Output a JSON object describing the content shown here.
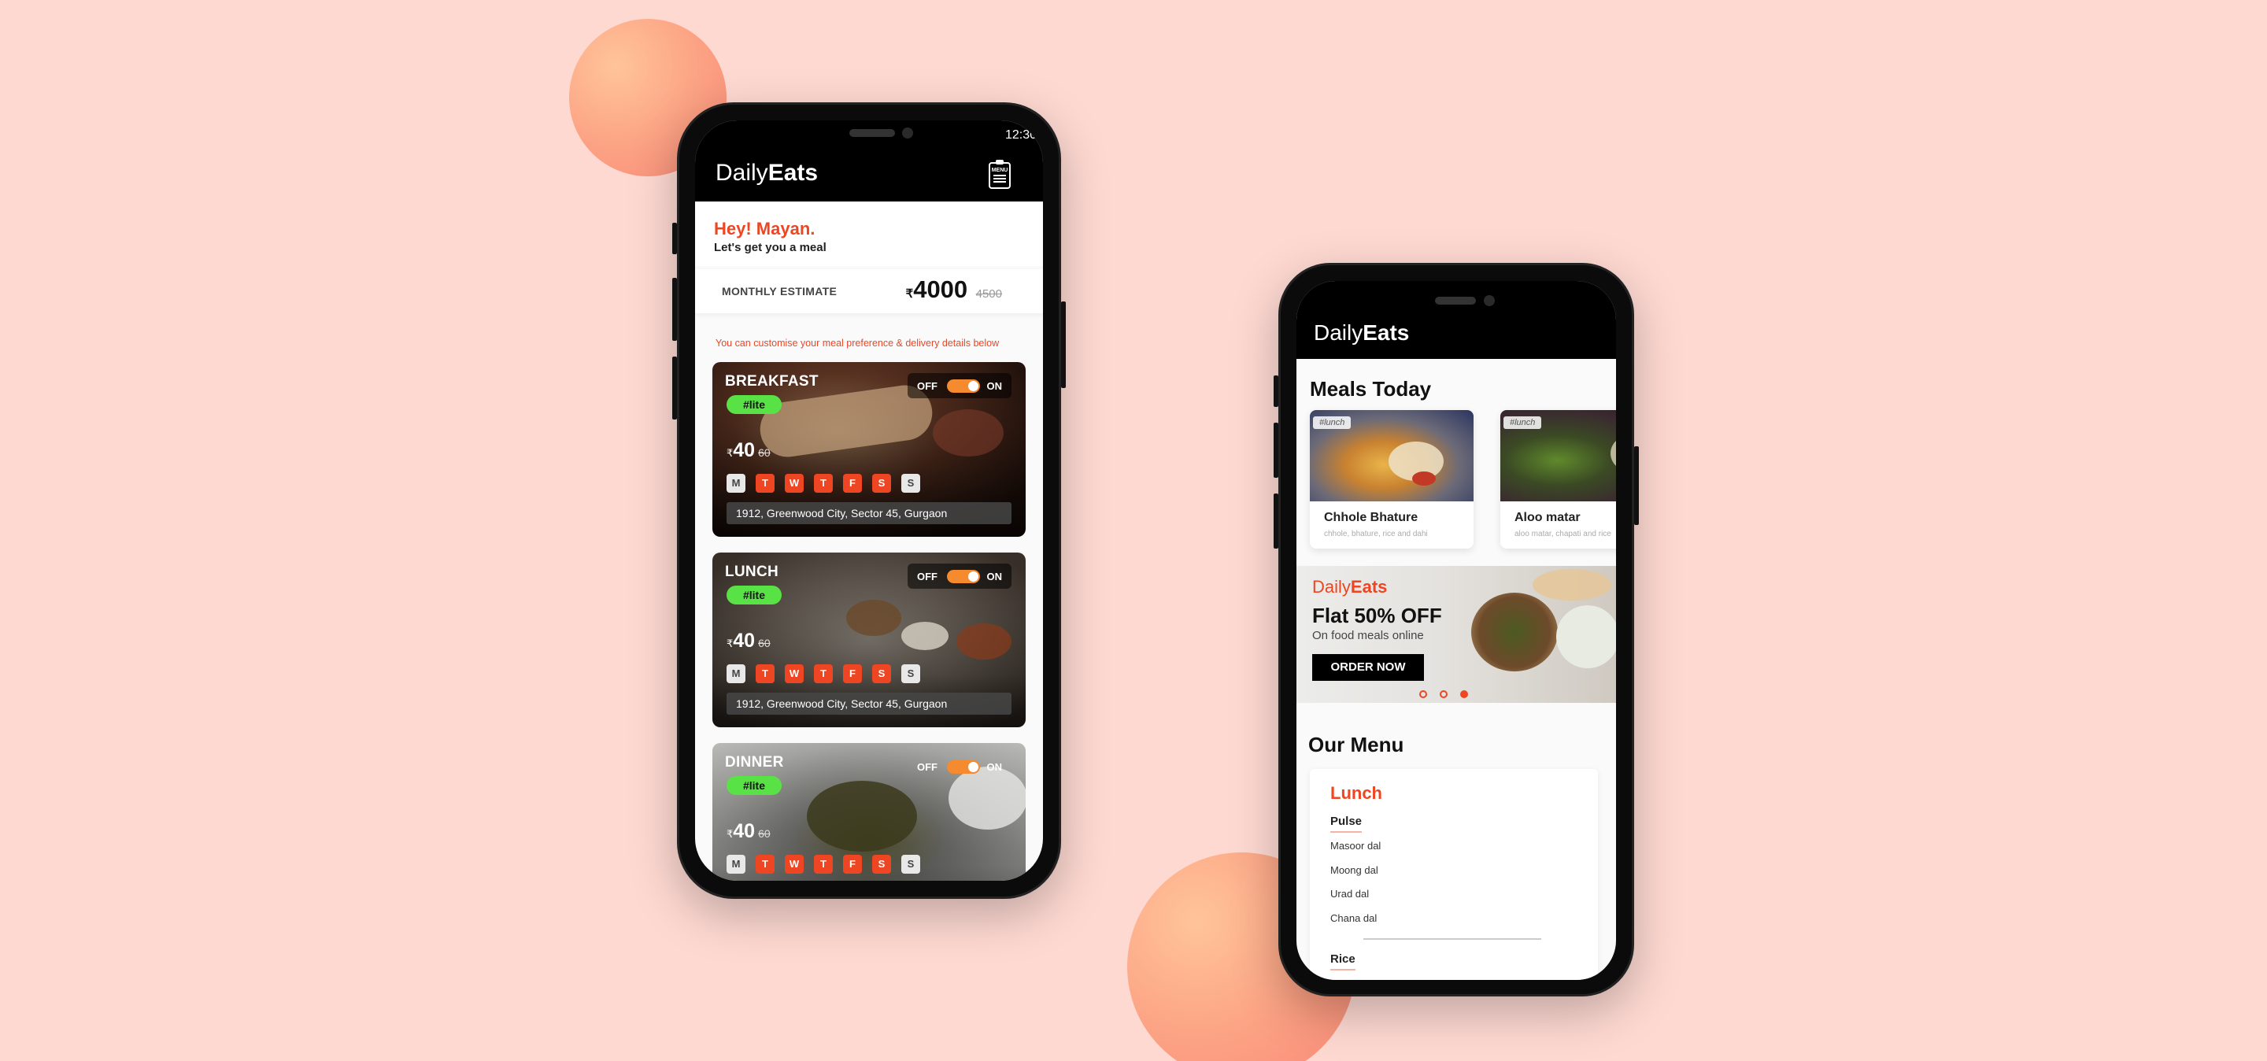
{
  "colors": {
    "accent": "#ee4523",
    "lite": "#59e245",
    "toggle": "#f68a2e",
    "background": "#fed9d2"
  },
  "phone1": {
    "time": "12:30",
    "brand_light": "Daily",
    "brand_bold": "Eats",
    "menu_icon": "clipboard-menu-icon",
    "menu_icon_text": "MENU",
    "greeting": "Hey! Mayan.",
    "greeting_sub": "Let's get you a meal",
    "estimate_label": "MONTHLY ESTIMATE",
    "currency": "₹",
    "estimate_value": "4000",
    "estimate_old": "4500",
    "hint": "You can customise your meal preference & delivery details below",
    "meals": [
      {
        "title": "BREAKFAST",
        "tag": "#lite",
        "off": "OFF",
        "on": "ON",
        "price": "40",
        "old": "60",
        "days": [
          "M",
          "T",
          "W",
          "T",
          "F",
          "S",
          "S"
        ],
        "address": "1912, Greenwood City, Sector 45, Gurgaon"
      },
      {
        "title": "LUNCH",
        "tag": "#lite",
        "off": "OFF",
        "on": "ON",
        "price": "40",
        "old": "60",
        "days": [
          "M",
          "T",
          "W",
          "T",
          "F",
          "S",
          "S"
        ],
        "address": "1912, Greenwood City, Sector 45, Gurgaon"
      },
      {
        "title": "DINNER",
        "tag": "#lite",
        "off": "OFF",
        "on": "ON",
        "price": "40",
        "old": "60",
        "days": [
          "M",
          "T",
          "W",
          "T",
          "F",
          "S",
          "S"
        ]
      }
    ]
  },
  "phone2": {
    "brand_light": "Daily",
    "brand_bold": "Eats",
    "meals_today": "Meals Today",
    "tiles": [
      {
        "tag": "#lunch",
        "name": "Chhole Bhature",
        "desc": "chhole, bhature, rice and dahi"
      },
      {
        "tag": "#lunch",
        "name": "Aloo matar",
        "desc": "aloo matar, chapati and rice"
      }
    ],
    "banner": {
      "brand_light": "Daily",
      "brand_bold": "Eats",
      "headline": "Flat 50% OFF",
      "sub": "On food meals online",
      "cta": "ORDER NOW"
    },
    "our_menu": "Our Menu",
    "menu_section": "Lunch",
    "pulse": "Pulse",
    "pulse_items": [
      "Masoor dal",
      "Moong dal",
      "Urad dal",
      "Chana dal"
    ],
    "rice": "Rice"
  }
}
